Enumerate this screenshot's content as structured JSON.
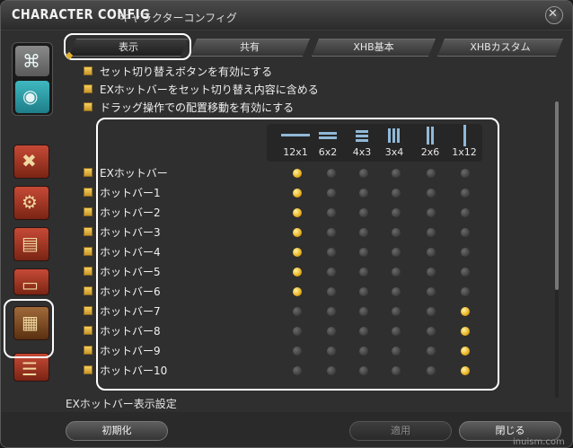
{
  "window": {
    "title_en": "CHARACTER CONFIG",
    "title_jp": "キャラクターコンフィグ",
    "close_icon": "✕"
  },
  "tabs": [
    {
      "label": "表示",
      "active": true
    },
    {
      "label": "共有",
      "active": false
    },
    {
      "label": "XHB基本",
      "active": false
    },
    {
      "label": "XHBカスタム",
      "active": false
    }
  ],
  "checkboxes": [
    {
      "label": "セット切り替えボタンを有効にする",
      "checked": true
    },
    {
      "label": "EXホットバーをセット切り替え内容に含める",
      "checked": true
    },
    {
      "label": "ドラッグ操作での配置移動を有効にする",
      "checked": true
    }
  ],
  "layouts": [
    "12x1",
    "6x2",
    "4x3",
    "3x4",
    "2x6",
    "1x12"
  ],
  "hotbars": [
    {
      "label": "EXホットバー",
      "selected": 0
    },
    {
      "label": "ホットバー1",
      "selected": 0
    },
    {
      "label": "ホットバー2",
      "selected": 0
    },
    {
      "label": "ホットバー3",
      "selected": 0
    },
    {
      "label": "ホットバー4",
      "selected": 0
    },
    {
      "label": "ホットバー5",
      "selected": 0
    },
    {
      "label": "ホットバー6",
      "selected": 0
    },
    {
      "label": "ホットバー7",
      "selected": 5
    },
    {
      "label": "ホットバー8",
      "selected": 5
    },
    {
      "label": "ホットバー9",
      "selected": 5
    },
    {
      "label": "ホットバー10",
      "selected": 5
    }
  ],
  "section_label": "EXホットバー表示設定",
  "footer": {
    "reset": "初期化",
    "apply": "適用",
    "close": "閉じる"
  },
  "watermark": "inuism.com",
  "sidebar": {
    "icons": [
      "gamepad-icon",
      "mouse-icon",
      "cross-arrows-icon",
      "gear-bag-icon",
      "card-icon",
      "bar-icon",
      "hotbar-icon",
      "chat-icon"
    ]
  },
  "colors": {
    "accent_gold": "#e8b020",
    "sidebar_red": "#c64a36",
    "sidebar_teal": "#2a9aa4"
  }
}
